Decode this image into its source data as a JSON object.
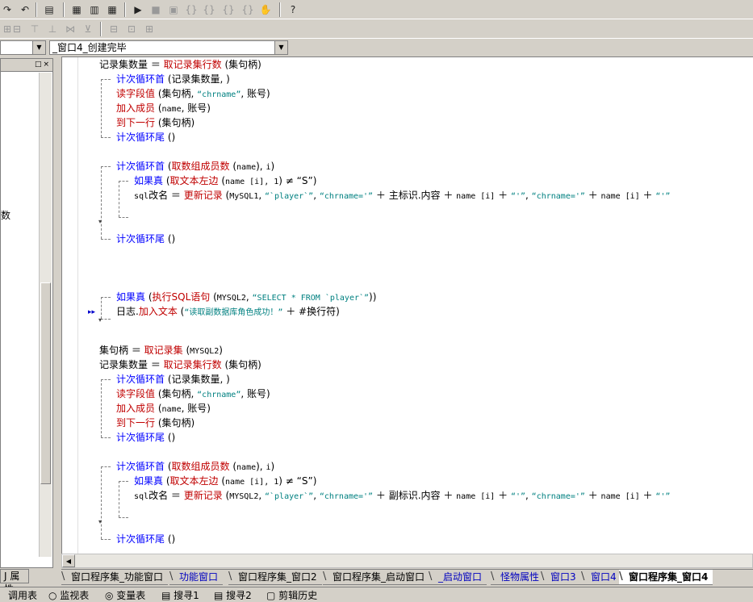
{
  "toolbar_combos": {
    "left_value": "",
    "right_value": "_窗口4_创建完毕"
  },
  "left_panel": {
    "partial_text": "数",
    "tab_label": "属性",
    "tab_glyph": "J"
  },
  "code_lines": [
    {
      "id": "l1",
      "parts": [
        [
          "v",
          "记录集数量 "
        ],
        [
          "v",
          "＝ "
        ],
        [
          "k",
          "取记录集行数"
        ],
        [
          "v",
          " (集句柄)"
        ]
      ]
    },
    {
      "id": "l2",
      "parts": [
        [
          "b",
          "计次循环首"
        ],
        [
          "v",
          " (记录集数量, )"
        ]
      ]
    },
    {
      "id": "l3",
      "parts": [
        [
          "k",
          "读字段值"
        ],
        [
          "v",
          " (集句柄, "
        ],
        [
          "s",
          "“chrname”"
        ],
        [
          "v",
          ", 账号)"
        ]
      ]
    },
    {
      "id": "l4",
      "parts": [
        [
          "k",
          "加入成员"
        ],
        [
          "v",
          " ("
        ],
        [
          "n",
          "name"
        ],
        [
          "v",
          ", 账号)"
        ]
      ]
    },
    {
      "id": "l5",
      "parts": [
        [
          "k",
          "到下一行"
        ],
        [
          "v",
          " (集句柄)"
        ]
      ]
    },
    {
      "id": "l6",
      "parts": [
        [
          "b",
          "计次循环尾"
        ],
        [
          "v",
          " ()"
        ]
      ]
    },
    {
      "id": "l7",
      "parts": [
        [
          "b",
          "计次循环首"
        ],
        [
          "v",
          " ("
        ],
        [
          "k",
          "取数组成员数"
        ],
        [
          "v",
          " ("
        ],
        [
          "n",
          "name"
        ],
        [
          "v",
          "), "
        ],
        [
          "n",
          "i"
        ],
        [
          "v",
          ")"
        ]
      ]
    },
    {
      "id": "l8",
      "parts": [
        [
          "b",
          "如果真"
        ],
        [
          "v",
          " ("
        ],
        [
          "k",
          "取文本左边"
        ],
        [
          "v",
          " ("
        ],
        [
          "n",
          "name [i], 1"
        ],
        [
          "v",
          ") ≠ "
        ],
        [
          "v",
          "“S”"
        ],
        [
          "v",
          ")"
        ]
      ]
    },
    {
      "id": "l9",
      "parts": [
        [
          "n",
          "sql"
        ],
        [
          "v",
          "改名 ＝ "
        ],
        [
          "k",
          "更新记录"
        ],
        [
          "v",
          " ("
        ],
        [
          "n",
          "MySQL1"
        ],
        [
          "v",
          ", "
        ],
        [
          "s",
          "“`player`”"
        ],
        [
          "v",
          ", "
        ],
        [
          "s",
          "“chrname='”"
        ],
        [
          "v",
          " ＋ 主标识.内容 ＋ "
        ],
        [
          "n",
          "name [i]"
        ],
        [
          "v",
          " ＋ "
        ],
        [
          "s",
          "“'”"
        ],
        [
          "v",
          ", "
        ],
        [
          "s",
          "“chrname='”"
        ],
        [
          "v",
          " ＋ "
        ],
        [
          "n",
          "name [i]"
        ],
        [
          "v",
          " ＋ "
        ],
        [
          "s",
          "“'”"
        ]
      ]
    },
    {
      "id": "l10",
      "parts": [
        [
          "b",
          "计次循环尾"
        ],
        [
          "v",
          " ()"
        ]
      ]
    },
    {
      "id": "l11",
      "parts": [
        [
          "b",
          "如果真"
        ],
        [
          "v",
          " ("
        ],
        [
          "k",
          "执行SQL语句"
        ],
        [
          "v",
          " ("
        ],
        [
          "n",
          "MYSQL2"
        ],
        [
          "v",
          ", "
        ],
        [
          "s",
          "“SELECT * FROM `player`”"
        ],
        [
          "v",
          "))"
        ]
      ]
    },
    {
      "id": "l12",
      "parts": [
        [
          "v",
          "日志."
        ],
        [
          "k",
          "加入文本"
        ],
        [
          "v",
          " ("
        ],
        [
          "s",
          "“读取副数据库角色成功！”"
        ],
        [
          "v",
          " ＋ #换行符)"
        ]
      ]
    },
    {
      "id": "l13",
      "parts": [
        [
          "v",
          "集句柄 ＝ "
        ],
        [
          "k",
          "取记录集"
        ],
        [
          "v",
          " ("
        ],
        [
          "n",
          "MYSQL2"
        ],
        [
          "v",
          ")"
        ]
      ]
    },
    {
      "id": "l14",
      "parts": [
        [
          "v",
          "记录集数量 ＝ "
        ],
        [
          "k",
          "取记录集行数"
        ],
        [
          "v",
          " (集句柄)"
        ]
      ]
    },
    {
      "id": "l15",
      "parts": [
        [
          "b",
          "计次循环首"
        ],
        [
          "v",
          " (记录集数量, )"
        ]
      ]
    },
    {
      "id": "l16",
      "parts": [
        [
          "k",
          "读字段值"
        ],
        [
          "v",
          " (集句柄, "
        ],
        [
          "s",
          "“chrname”"
        ],
        [
          "v",
          ", 账号)"
        ]
      ]
    },
    {
      "id": "l17",
      "parts": [
        [
          "k",
          "加入成员"
        ],
        [
          "v",
          " ("
        ],
        [
          "n",
          "name"
        ],
        [
          "v",
          ", 账号)"
        ]
      ]
    },
    {
      "id": "l18",
      "parts": [
        [
          "k",
          "到下一行"
        ],
        [
          "v",
          " (集句柄)"
        ]
      ]
    },
    {
      "id": "l19",
      "parts": [
        [
          "b",
          "计次循环尾"
        ],
        [
          "v",
          " ()"
        ]
      ]
    },
    {
      "id": "l20",
      "parts": [
        [
          "b",
          "计次循环首"
        ],
        [
          "v",
          " ("
        ],
        [
          "k",
          "取数组成员数"
        ],
        [
          "v",
          " ("
        ],
        [
          "n",
          "name"
        ],
        [
          "v",
          "), "
        ],
        [
          "n",
          "i"
        ],
        [
          "v",
          ")"
        ]
      ]
    },
    {
      "id": "l21",
      "parts": [
        [
          "b",
          "如果真"
        ],
        [
          "v",
          " ("
        ],
        [
          "k",
          "取文本左边"
        ],
        [
          "v",
          " ("
        ],
        [
          "n",
          "name [i], 1"
        ],
        [
          "v",
          ") ≠ "
        ],
        [
          "v",
          "“S”"
        ],
        [
          "v",
          ")"
        ]
      ]
    },
    {
      "id": "l22",
      "parts": [
        [
          "n",
          "sql"
        ],
        [
          "v",
          "改名 ＝ "
        ],
        [
          "k",
          "更新记录"
        ],
        [
          "v",
          " ("
        ],
        [
          "n",
          "MYSQL2"
        ],
        [
          "v",
          ", "
        ],
        [
          "s",
          "“`player`”"
        ],
        [
          "v",
          ", "
        ],
        [
          "s",
          "“chrname='”"
        ],
        [
          "v",
          " ＋ 副标识.内容 ＋ "
        ],
        [
          "n",
          "name [i]"
        ],
        [
          "v",
          " ＋ "
        ],
        [
          "s",
          "“'”"
        ],
        [
          "v",
          ", "
        ],
        [
          "s",
          "“chrname='”"
        ],
        [
          "v",
          " ＋ "
        ],
        [
          "n",
          "name [i]"
        ],
        [
          "v",
          " ＋ "
        ],
        [
          "s",
          "“'”"
        ]
      ]
    },
    {
      "id": "l23",
      "parts": [
        [
          "b",
          "计次循环尾"
        ],
        [
          "v",
          " ()"
        ]
      ]
    }
  ],
  "tabs": [
    {
      "label": "窗口程序集_功能窗口",
      "style": "normal"
    },
    {
      "label": "功能窗口",
      "style": "blue"
    },
    {
      "label": "窗口程序集_窗口2",
      "style": "normal"
    },
    {
      "label": "窗口程序集_启动窗口",
      "style": "normal"
    },
    {
      "label": "_启动窗口",
      "style": "blue"
    },
    {
      "label": "怪物属性",
      "style": "blue"
    },
    {
      "label": "窗口3",
      "style": "blue"
    },
    {
      "label": "窗口4",
      "style": "blue"
    },
    {
      "label": "窗口程序集_窗口4",
      "style": "active"
    }
  ],
  "status_tabs": [
    "调用表",
    "监视表",
    "变量表",
    "搜寻1",
    "搜寻2",
    "剪辑历史"
  ]
}
